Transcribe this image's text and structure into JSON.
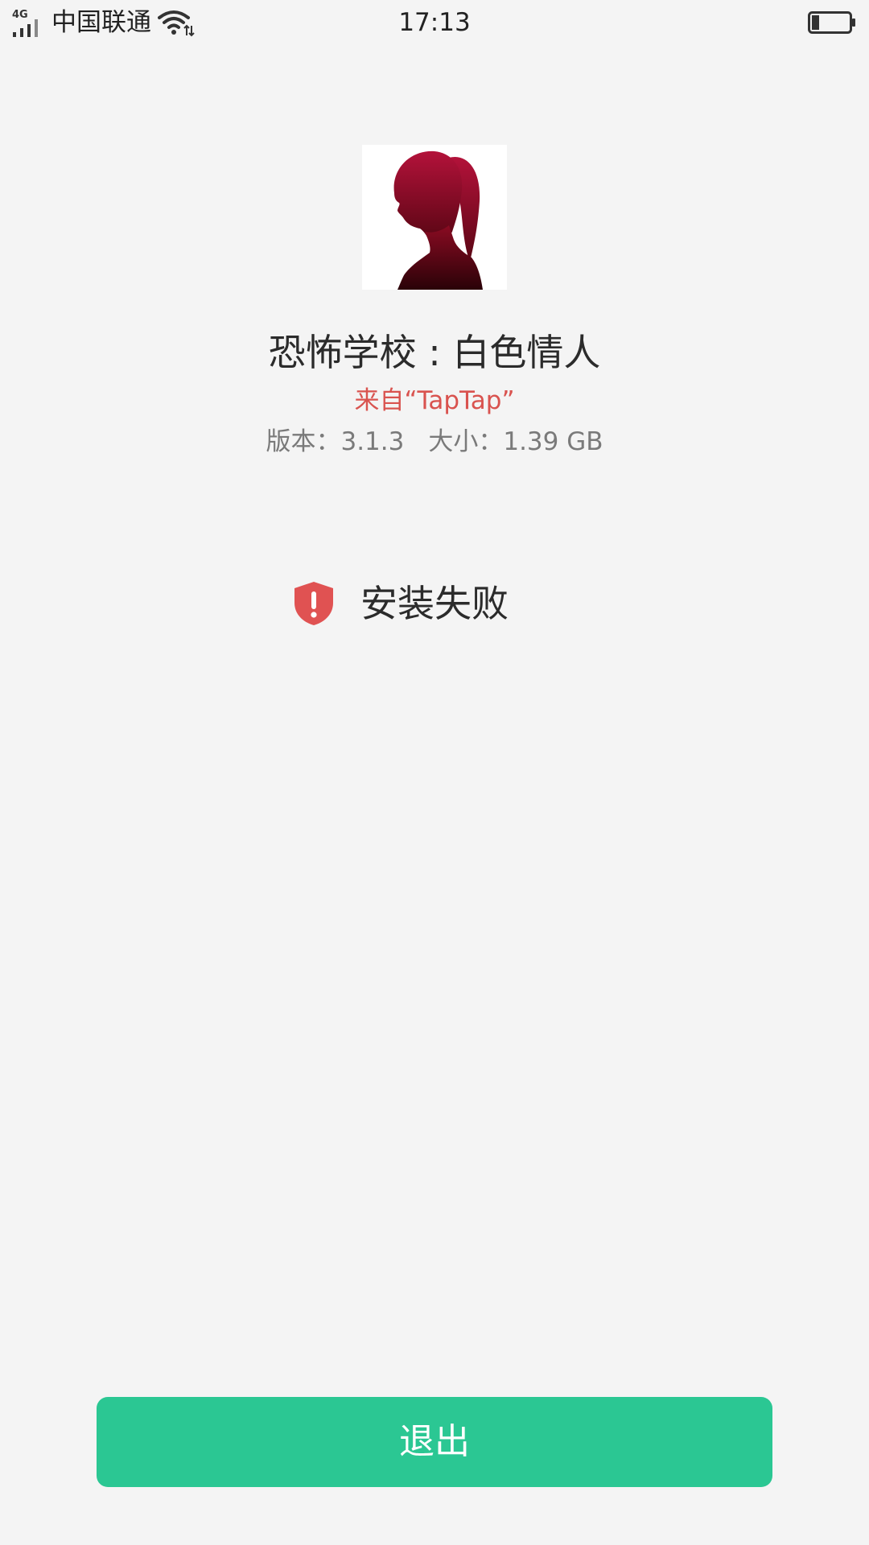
{
  "status_bar": {
    "network": "4G",
    "carrier": "中国联通",
    "time": "17:13",
    "battery_level": 0.2,
    "icons": [
      "signal-icon",
      "wifi-icon",
      "battery-icon"
    ]
  },
  "app": {
    "name": "恐怖学校 : 白色情人",
    "source": "来自“TapTap”",
    "version": "版本：3.1.3",
    "size": "大小：1.39 GB",
    "icon": "app-icon-silhouette"
  },
  "status": {
    "icon": "shield-alert-icon",
    "text": "安装失败"
  },
  "actions": {
    "exit_label": "退出"
  },
  "colors": {
    "background": "#f4f4f4",
    "accent": "#2bc793",
    "source_text": "#d9534f",
    "shield": "#e05252",
    "meta_text": "#7a7a7a"
  }
}
